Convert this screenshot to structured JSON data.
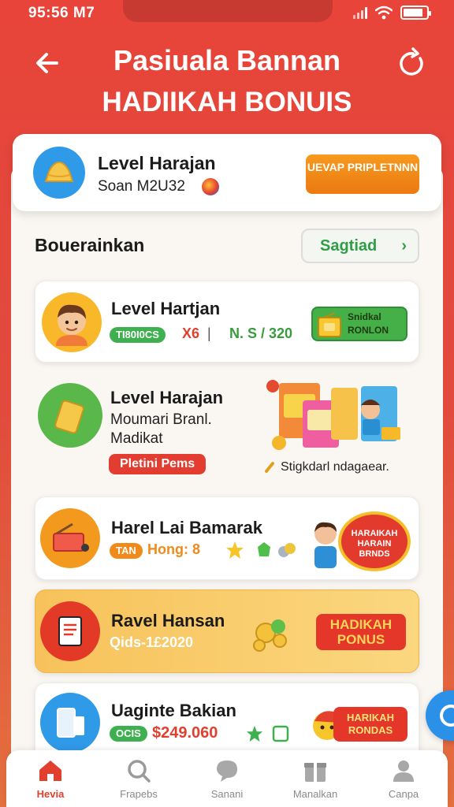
{
  "status_bar": {
    "time": "95:56 M7",
    "battery_level": 0.85
  },
  "header": {
    "title_line1": "Pasiuala Bannan",
    "title_line2": "HADIIKAH BONUIS"
  },
  "level_card": {
    "title": "Level Harajan",
    "subtitle": "Soan M2U32",
    "cta": "UEVAP PRIPLETNNN"
  },
  "section": {
    "title": "Bouerainkan",
    "see_all": "Sagtiad"
  },
  "cards": [
    {
      "title": "Level Hartjan",
      "pill": "TI80I0CS",
      "meta_x": "X6",
      "meta_sep": "|",
      "meta_value": "N. S / 320",
      "badge": "Snidkal RONLON"
    },
    {
      "title": "Level Harajan",
      "line2": "Moumari Branl.",
      "line3": "Madikat",
      "pill": "Pletini Pems",
      "caption": "Stigkdarl ndagaear."
    },
    {
      "title": "Harel Lai Bamarak",
      "pill": "TAN",
      "meta": "Hong: 8",
      "badge": "HARAIKAH HARAIN BRNDS"
    },
    {
      "title": "Ravel Hansan",
      "meta": "Qids-1£2020",
      "badge": "HADIKAH PONUS"
    },
    {
      "title": "Uaginte Bakian",
      "pill": "OCIS",
      "price": "$249.060",
      "badge": "HARIKAH RONDAS"
    }
  ],
  "nav": [
    {
      "label": "Hevia",
      "icon": "home-icon",
      "active": true
    },
    {
      "label": "Frapebs",
      "icon": "search-icon",
      "active": false
    },
    {
      "label": "Sanani",
      "icon": "chat-icon",
      "active": false
    },
    {
      "label": "Manalkan",
      "icon": "gift-icon",
      "active": false
    },
    {
      "label": "Canpa",
      "icon": "profile-icon",
      "active": false
    }
  ],
  "colors": {
    "primary_red": "#e8443a",
    "accent_orange": "#f08a1a",
    "accent_green": "#3fb04f",
    "accent_blue": "#2f9ae8"
  }
}
